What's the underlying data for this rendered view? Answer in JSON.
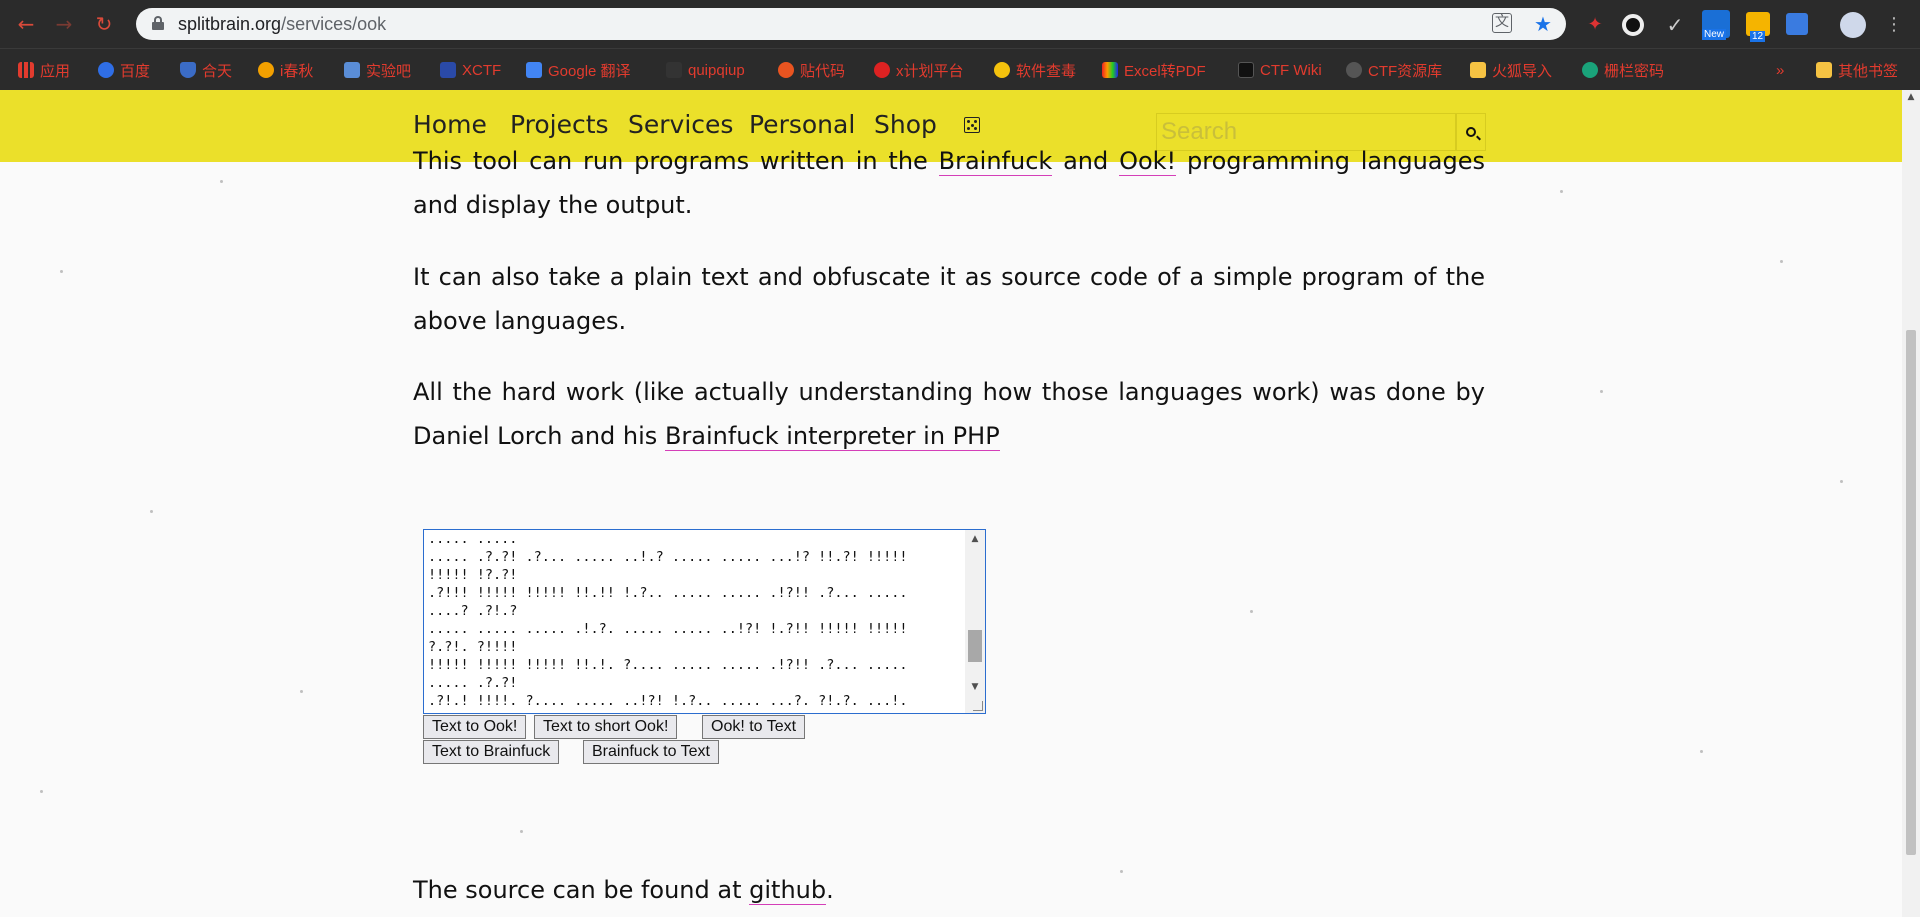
{
  "browser": {
    "url_domain": "splitbrain.org",
    "url_path": "/services/ook",
    "bookmarks": [
      {
        "label": "应用",
        "color": "#e23b2e"
      },
      {
        "label": "百度",
        "color": "#2f6ee6"
      },
      {
        "label": "合天",
        "color": "#3b6cc6"
      },
      {
        "label": "i春秋",
        "color": "#f2a000"
      },
      {
        "label": "实验吧",
        "color": "#5a8dd6"
      },
      {
        "label": "XCTF",
        "color": "#2a4aa8"
      },
      {
        "label": "Google 翻译",
        "color": "#4285f4"
      },
      {
        "label": "quipqiup",
        "color": "#333333"
      },
      {
        "label": "贴代码",
        "color": "#e95420"
      },
      {
        "label": "x计划平台",
        "color": "#d22"
      },
      {
        "label": "软件查毒",
        "color": "#f4c20d"
      },
      {
        "label": "Excel转PDF",
        "color": "#8a2be2"
      },
      {
        "label": "CTF Wiki",
        "color": "#111111"
      },
      {
        "label": "CTF资源库",
        "color": "#555555"
      },
      {
        "label": "火狐导入",
        "color": "#f6c343"
      },
      {
        "label": "栅栏密码",
        "color": "#1aa37a"
      },
      {
        "label": "其他书签",
        "color": "#f6c343"
      }
    ],
    "extension_badge_new": "New",
    "extension_badge_count": "12"
  },
  "site_nav": {
    "items": [
      "Home",
      "Projects",
      "Services",
      "Personal",
      "Shop"
    ],
    "search_placeholder": "Search"
  },
  "content": {
    "p1_before": "This tool can run programs written in the ",
    "p1_link1": "Brainfuck",
    "p1_mid": " and ",
    "p1_link2": "Ook!",
    "p1_after": " programming languages and display the output.",
    "p2": "It can also take a plain text and obfuscate it as source code of a simple program of the above languages.",
    "p3_before": "All the hard work (like actually understanding how those languages work) was done by Daniel Lorch and his ",
    "p3_link": "Brainfuck interpreter in PHP",
    "textarea_value": "..... .....\n..... .?.?! .?... ..... ..!.? ..... ..... ...!? !!.?! !!!!!\n!!!!! !?.?!\n.?!!! !!!!! !!!!! !!.!! !.?.. ..... ..... .!?!! .?... .....\n....? .?!.?\n..... ..... ..... .!.?. ..... ..... ..!?! !.?!! !!!!! !!!!!\n?.?!. ?!!!!\n!!!!! !!!!! !!!!! !!.!. ?.... ..... ..... .!?!! .?... .....\n..... .?.?!\n.?!.! !!!!. ?.... ..... ..!?! !.?.. ..... ...?. ?!.?. ...!.\n?.",
    "buttons_row1": [
      "Text to Ook!",
      "Text to short Ook!",
      "Ook! to Text"
    ],
    "buttons_row2": [
      "Text to Brainfuck",
      "Brainfuck to Text"
    ],
    "source_before": "The source can be found at ",
    "source_link": "github",
    "source_after": "."
  }
}
